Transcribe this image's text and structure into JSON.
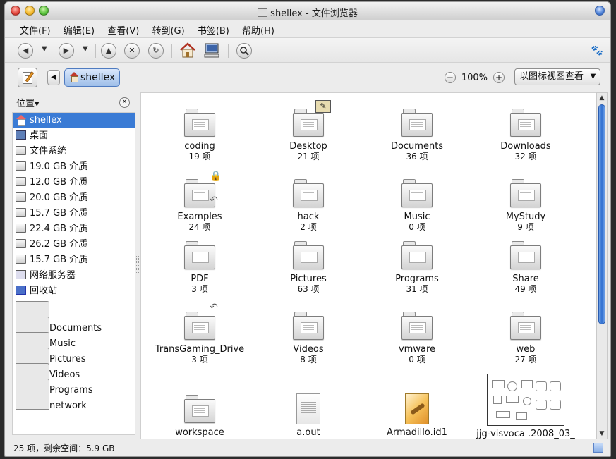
{
  "window": {
    "title": "shellex - 文件浏览器"
  },
  "menu": [
    "文件(F)",
    "编辑(E)",
    "查看(V)",
    "转到(G)",
    "书签(B)",
    "帮助(H)"
  ],
  "toolbar": {
    "buttons": [
      "back-icon",
      "forward-icon",
      "up-icon",
      "stop-icon",
      "reload-icon",
      "home-icon",
      "computer-icon",
      "search-icon"
    ]
  },
  "location": {
    "back_arrow": "◀",
    "crumb": "shellex",
    "zoom_value": "100%",
    "zoom_out": "−",
    "zoom_in": "+",
    "view_mode": "以图标视图查看"
  },
  "sidebar": {
    "header": "位置▾",
    "items": [
      {
        "label": "shellex",
        "icon": "home-icon"
      },
      {
        "label": "桌面",
        "icon": "desktop-icon"
      },
      {
        "label": "文件系统",
        "icon": "drive-icon"
      },
      {
        "label": "19.0 GB 介质",
        "icon": "drive-icon"
      },
      {
        "label": "12.0 GB 介质",
        "icon": "drive-icon"
      },
      {
        "label": "20.0 GB 介质",
        "icon": "drive-icon"
      },
      {
        "label": "15.7 GB 介质",
        "icon": "drive-icon"
      },
      {
        "label": "22.4 GB 介质",
        "icon": "drive-icon"
      },
      {
        "label": "26.2 GB 介质",
        "icon": "drive-icon"
      },
      {
        "label": "15.7 GB 介质",
        "icon": "drive-icon"
      },
      {
        "label": "网络服务器",
        "icon": "network-icon"
      },
      {
        "label": "回收站",
        "icon": "trash-icon"
      }
    ],
    "bookmarks": [
      "Documents",
      "Music",
      "Pictures",
      "Videos",
      "Programs",
      "network"
    ]
  },
  "files": [
    {
      "name": "coding",
      "count": "19 项"
    },
    {
      "name": "Desktop",
      "count": "21 项"
    },
    {
      "name": "Documents",
      "count": "36 项"
    },
    {
      "name": "Downloads",
      "count": "32 项"
    },
    {
      "name": "Examples",
      "count": "24 项"
    },
    {
      "name": "hack",
      "count": "2 项"
    },
    {
      "name": "Music",
      "count": "0 项"
    },
    {
      "name": "MyStudy",
      "count": "9 项"
    },
    {
      "name": "PDF",
      "count": "3 项"
    },
    {
      "name": "Pictures",
      "count": "63 项"
    },
    {
      "name": "Programs",
      "count": "31 项"
    },
    {
      "name": "Share",
      "count": "49 项"
    },
    {
      "name": "TransGaming_Drive",
      "count": "3 项"
    },
    {
      "name": "Videos",
      "count": "8 项"
    },
    {
      "name": "vmware",
      "count": "0 项"
    },
    {
      "name": "web",
      "count": "27 项"
    },
    {
      "name": "workspace",
      "count": ""
    },
    {
      "name": "a.out",
      "count": ""
    },
    {
      "name": "Armadillo.id1",
      "count": ""
    },
    {
      "name": "jjg-visvoca .2008_03_",
      "count": ""
    }
  ],
  "status": "25 项，剩余空间：5.9 GB",
  "colors": {
    "selection": "#3a7bd5",
    "scroll_thumb": "#2f6fd0"
  }
}
